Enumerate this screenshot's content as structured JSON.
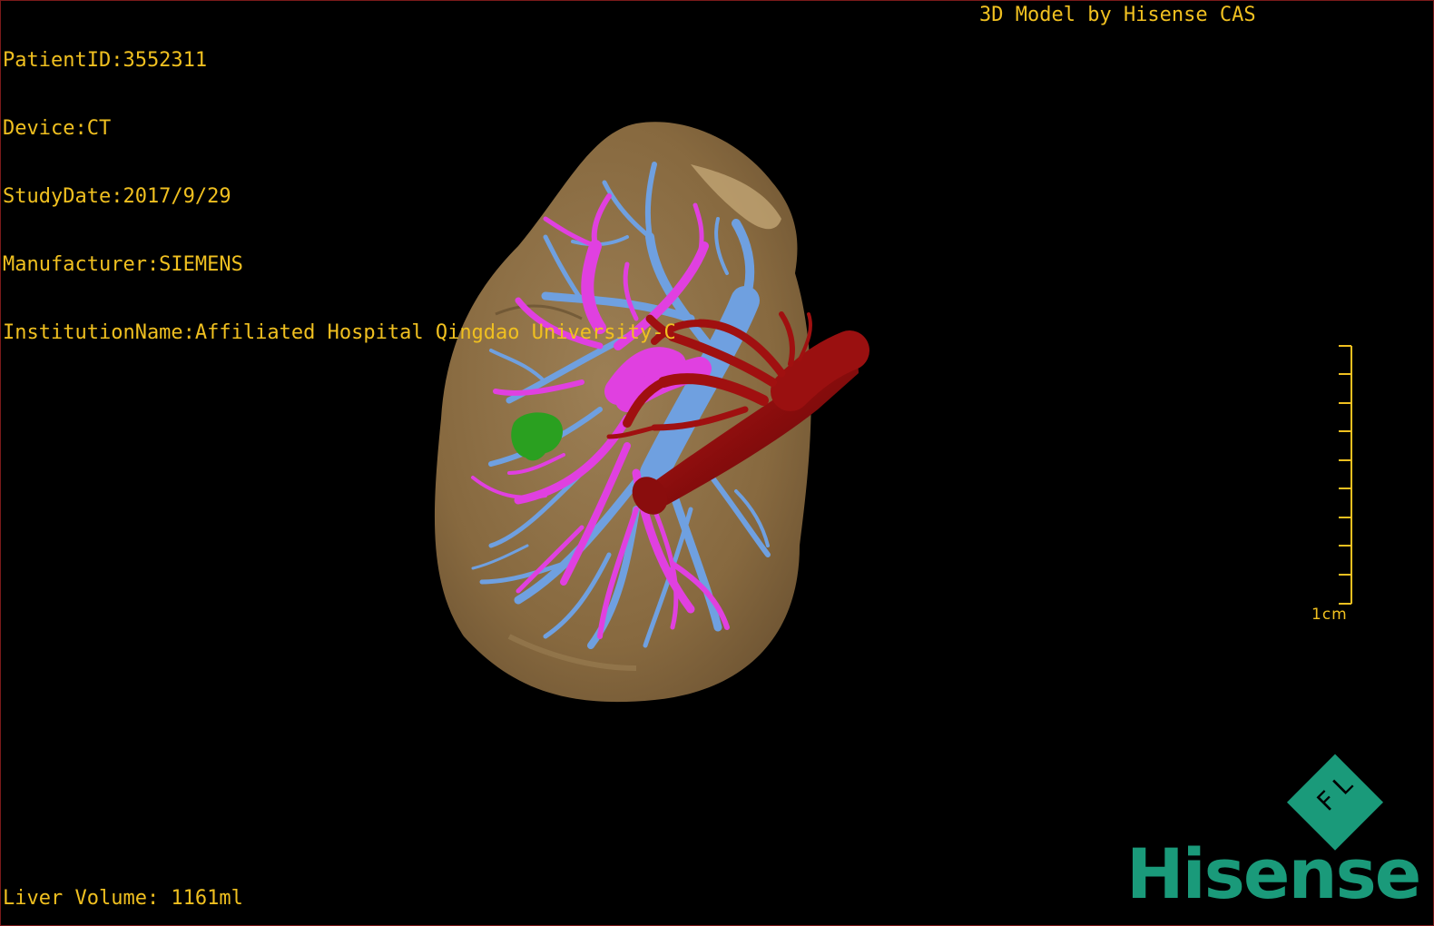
{
  "dicom": {
    "patient_id": "PatientID:3552311",
    "device": "Device:CT",
    "study_date": "StudyDate:2017/9/29",
    "manufacturer": "Manufacturer:SIEMENS",
    "institution": "InstitutionName:Affiliated Hospital Qingdao University-C"
  },
  "brand_caption": "3D Model by Hisense CAS",
  "liver_volume": "Liver Volume: 1161ml",
  "scale_bar": {
    "label": "1cm"
  },
  "logo": {
    "text": "Hisense",
    "badge_letters": "F L"
  },
  "colors": {
    "overlay_text": "#f0c020",
    "liver": "#8b6f47",
    "portal_vein": "#6fa0e0",
    "hepatic_vein": "#e040e0",
    "artery_ivc": "#a01010",
    "lesion": "#2aa020",
    "logo": "#1a9a7a"
  }
}
